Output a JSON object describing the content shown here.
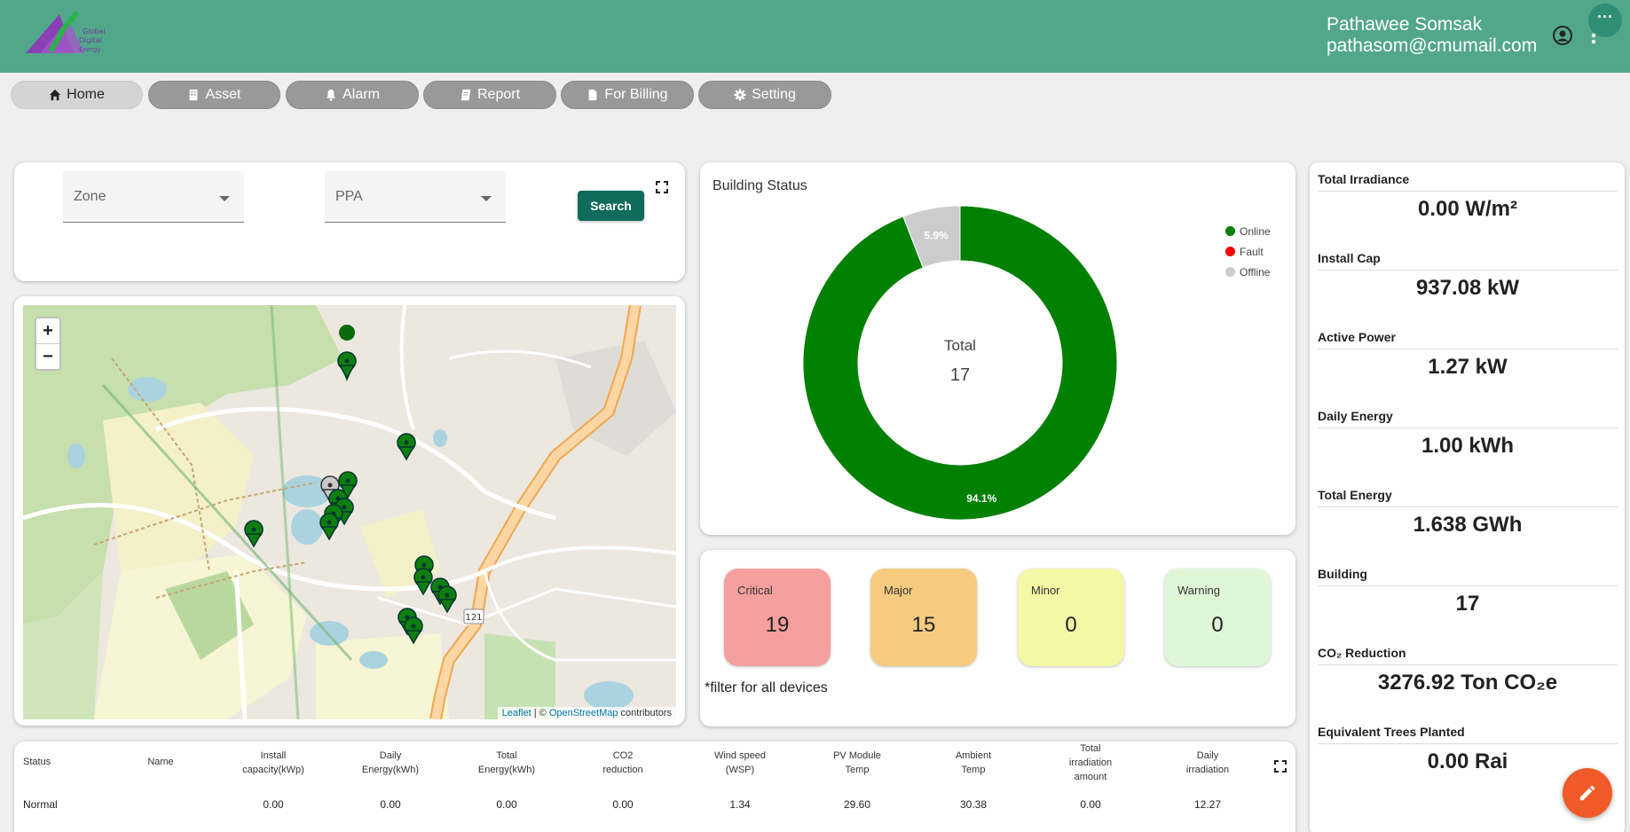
{
  "user": {
    "name": "Pathawee Somsak",
    "email": "pathasom@cmumail.com"
  },
  "header": {
    "more_label": "···"
  },
  "nav": [
    {
      "label": "Home",
      "icon": "home-icon",
      "active": true
    },
    {
      "label": "Asset",
      "icon": "building-icon"
    },
    {
      "label": "Alarm",
      "icon": "bell-icon"
    },
    {
      "label": "Report",
      "icon": "book-icon"
    },
    {
      "label": "For Billing",
      "icon": "file-icon"
    },
    {
      "label": "Setting",
      "icon": "gear-icon"
    }
  ],
  "filter": {
    "zone_label": "Zone",
    "ppa_label": "PPA",
    "search_label": "Search"
  },
  "map": {
    "zoom_in": "+",
    "zoom_out": "−",
    "attribution": {
      "leaflet": "Leaflet",
      "sep": " | © ",
      "osm": "OpenStreetMap",
      "suffix": " contributors"
    },
    "route_label": "121"
  },
  "building_status": {
    "title": "Building Status",
    "center_label": "Total",
    "total": "17",
    "legend": [
      {
        "label": "Online",
        "color": "#008000"
      },
      {
        "label": "Fault",
        "color": "#ff0000"
      },
      {
        "label": "Offline",
        "color": "#cccccc"
      }
    ],
    "chart_data": {
      "type": "pie",
      "categories": [
        "Online",
        "Fault",
        "Offline"
      ],
      "values": [
        94.1,
        0,
        5.9
      ],
      "labels": [
        "94.1%",
        "",
        "5.9%"
      ]
    }
  },
  "alarms": [
    {
      "label": "Critical",
      "value": "19",
      "color": "#f5a09e"
    },
    {
      "label": "Major",
      "value": "15",
      "color": "#f6cb80"
    },
    {
      "label": "Minor",
      "value": "0",
      "color": "#f3f7a6"
    },
    {
      "label": "Warning",
      "value": "0",
      "color": "#dff7d6"
    }
  ],
  "alarm_note": "*filter for all devices",
  "stats": [
    {
      "label": "Total Irradiance",
      "value": "0.00 W/m²"
    },
    {
      "label": "Install Cap",
      "value": "937.08 kW"
    },
    {
      "label": "Active Power",
      "value": "1.27 kW"
    },
    {
      "label": "Daily Energy",
      "value": "1.00 kWh"
    },
    {
      "label": "Total Energy",
      "value": "1.638 GWh"
    },
    {
      "label": "Building",
      "value": "17"
    },
    {
      "label": "CO₂ Reduction",
      "value": "3276.92 Ton CO₂e"
    },
    {
      "label": "Equivalent Trees Planted",
      "value": "0.00 Rai"
    }
  ],
  "table": {
    "headers": [
      "Status",
      "Name",
      "Install\ncapacity(kWp)",
      "Daily\nEnergy(kWh)",
      "Total\nEnergy(kWh)",
      "CO2\nreduction",
      "Wind speed\n(WSP)",
      "PV Module\nTemp",
      "Ambient\nTemp",
      "Total\nirradiation\namount",
      "Daily\nirradiation"
    ],
    "rows": [
      [
        "Normal",
        "",
        "0.00",
        "0.00",
        "0.00",
        "0.00",
        "1.34",
        "29.60",
        "30.38",
        "0.00",
        "12.27"
      ]
    ]
  }
}
